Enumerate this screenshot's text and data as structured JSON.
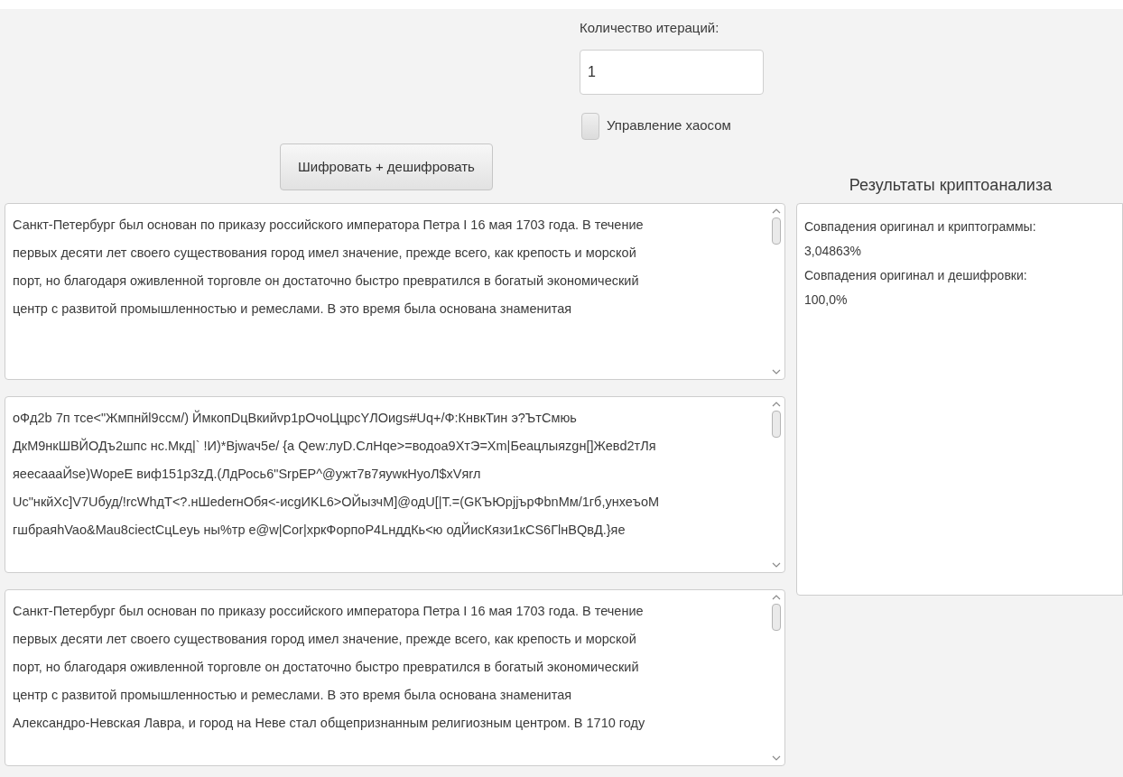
{
  "controls": {
    "iterations": {
      "label": "Количество итераций:",
      "value": "1"
    },
    "chaos_control": {
      "label": "Управление хаосом",
      "checked": false
    },
    "run_button": "Шифровать + дешифровать"
  },
  "text_areas": [
    {
      "lines": [
        "Санкт-Петербург был основан по приказу российского императора Петра I 16 мая 1703 года. В течение",
        "первых десяти лет своего существования город имел значение, прежде всего, как крепость и морской",
        "порт, но благодаря оживленной торговле он достаточно быстро превратился в богатый экономический",
        "центр с развитой промышленностью и ремеслами. В это время была основана знаменитая"
      ]
    },
    {
      "lines": [
        "оФд2b 7п тсе<\"Жмпнйl9ccм/) ЙмкопDцBкийvp1pОчоЦцрсYЛОиgs#Uq+/Ф:КнвкТин э?ЪтСмюь",
        "ДкМ9нкШВЙОДъ2шпс нс.Мкд|` !И)*Bjwач5е/ {а Qew:луD.СлHqe>=водоа9XтЭ=Xm|Беацлыяzgн[]Жевd2тЛя",
        "яеесаааЙse)WopeE виф151p3zД.(ЛдРось6\"SrpEP^@ужт7в7яуwкНуоЛ$xVяrл",
        "Uc\"нкйXc]V7Uбуд/!rcWhдT<?.нШederнОбя<-исgИKL6>ОЙызчМ]@одU[|T.=(GКЪЮpjjърФbnМм/1гб,унхеъоМ",
        "гшбраяhVao&Mau8ciectCцLeуь ны%тр е@w|Cor|xpкФорпоР4LнддКь<ю одЙисКязи1кCS6ГlнBQвД.}яе"
      ]
    },
    {
      "lines": [
        "Санкт-Петербург был основан по приказу российского императора Петра I 16 мая 1703 года. В течение",
        "первых десяти лет своего существования город имел значение, прежде всего, как крепость и морской",
        "порт, но благодаря оживленной торговле он достаточно быстро превратился в богатый экономический",
        "центр с развитой промышленностью и ремеслами. В это время была основана знаменитая",
        "Александро-Невская Лавра, и город на Неве стал общепризнанным религиозным центром. В 1710 году"
      ]
    }
  ],
  "results": {
    "title": "Результаты криптоанализа",
    "lines": [
      "Совпадения оригинал и криптограммы:",
      "3,04863%",
      "Совпадения оригинал и дешифровки:",
      "100,0%"
    ]
  }
}
